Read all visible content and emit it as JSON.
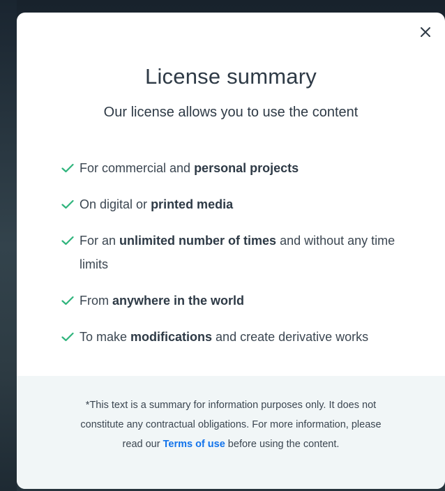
{
  "modal": {
    "title": "License summary",
    "subtitle": "Our license allows you to use the content",
    "close_icon": "close-icon",
    "check_color": "#2fb47c",
    "items": [
      {
        "prefix": "For commercial and ",
        "bold": "personal projects",
        "suffix": ""
      },
      {
        "prefix": "On digital or ",
        "bold": "printed media",
        "suffix": ""
      },
      {
        "prefix": "For an ",
        "bold": "unlimited number of times",
        "suffix": " and without any time limits"
      },
      {
        "prefix": "From ",
        "bold": "anywhere in the world",
        "suffix": ""
      },
      {
        "prefix": "To make ",
        "bold": "modifications",
        "suffix": " and create derivative works"
      }
    ],
    "footer": {
      "text_before": "*This text is a summary for information purposes only. It does not constitute any contractual obligations. For more information, please read our ",
      "link_label": "Terms of use",
      "text_after": " before using the content.",
      "link_color": "#1273eb"
    }
  }
}
